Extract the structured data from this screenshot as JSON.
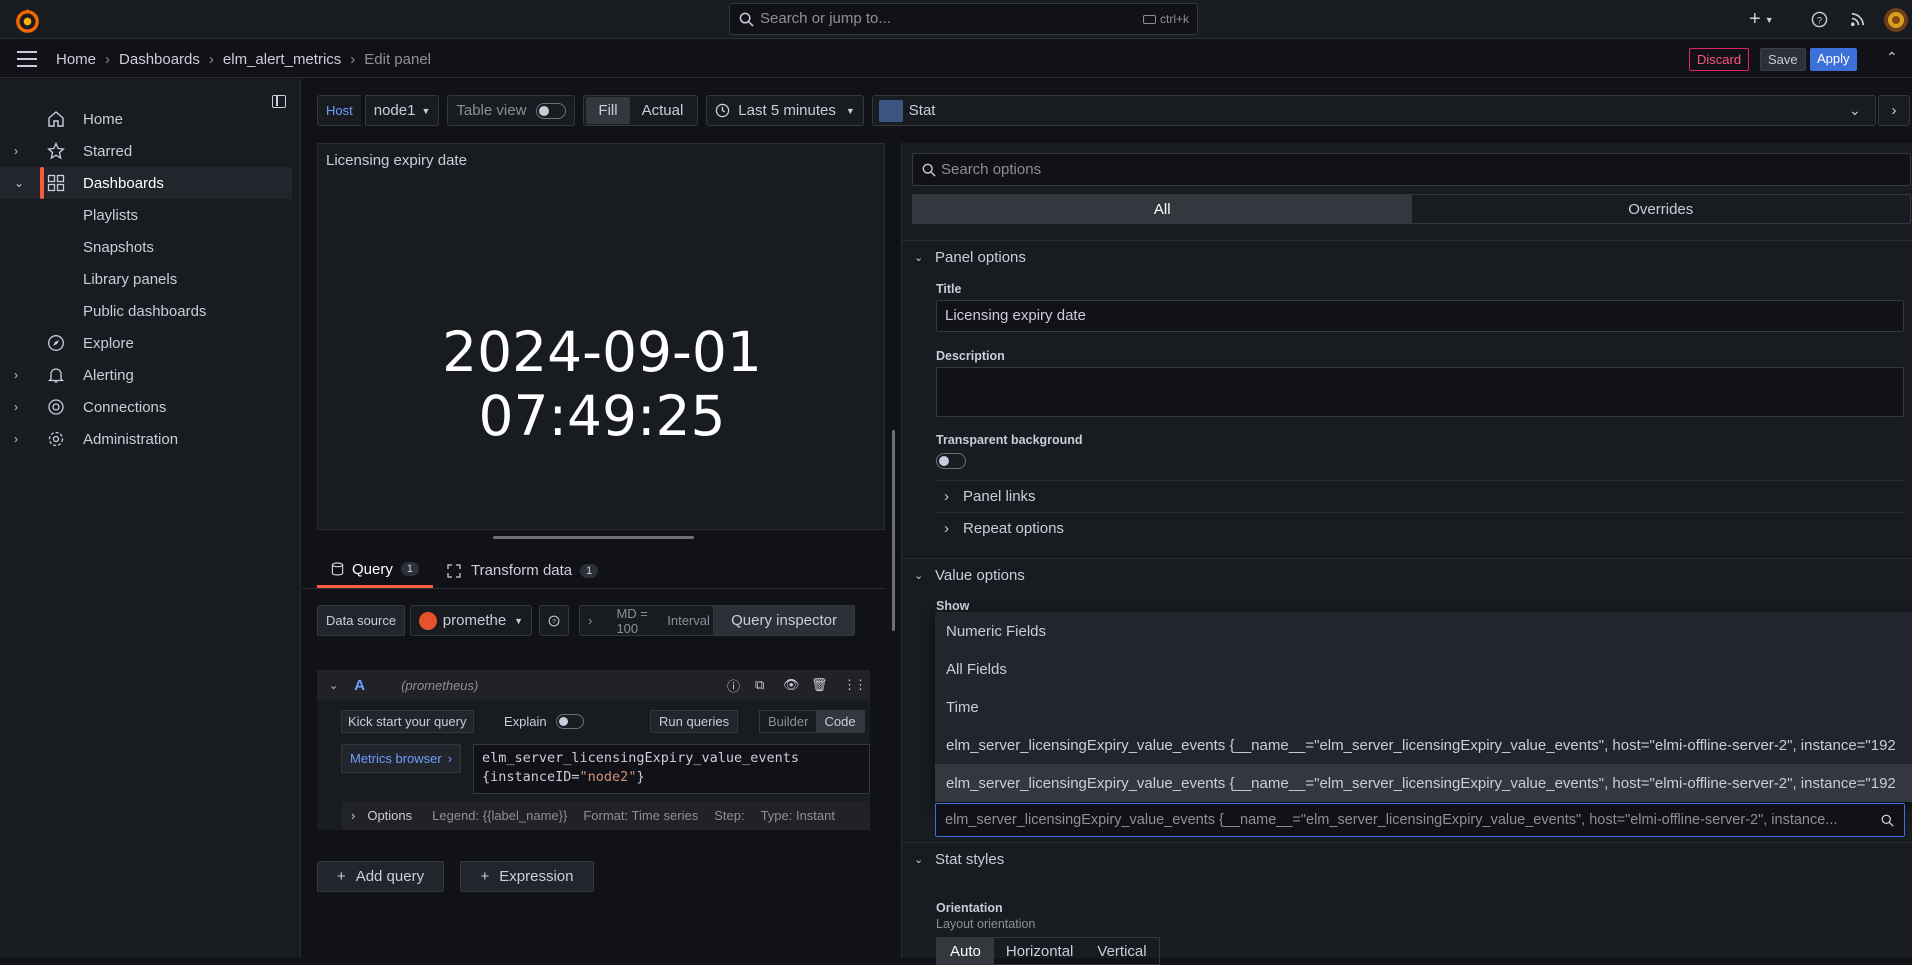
{
  "topbar": {
    "search_placeholder": "Search or jump to...",
    "shortcut": "ctrl+k",
    "plus": "+"
  },
  "breadcrumbs": [
    "Home",
    "Dashboards",
    "elm_alert_metrics",
    "Edit panel"
  ],
  "actions": {
    "discard": "Discard",
    "save": "Save",
    "apply": "Apply"
  },
  "sidebar": {
    "items": [
      {
        "label": "Home",
        "icon": "home-icon",
        "expand": false
      },
      {
        "label": "Starred",
        "icon": "star-icon",
        "expand": true
      },
      {
        "label": "Dashboards",
        "icon": "apps-icon",
        "expand": true,
        "active": true
      },
      {
        "label": "Playlists",
        "sub": true
      },
      {
        "label": "Snapshots",
        "sub": true
      },
      {
        "label": "Library panels",
        "sub": true
      },
      {
        "label": "Public dashboards",
        "sub": true
      },
      {
        "label": "Explore",
        "icon": "compass-icon",
        "expand": false
      },
      {
        "label": "Alerting",
        "icon": "bell-icon",
        "expand": true
      },
      {
        "label": "Connections",
        "icon": "connections-icon",
        "expand": true
      },
      {
        "label": "Administration",
        "icon": "gear-icon",
        "expand": true
      }
    ]
  },
  "toolbar": {
    "host_label": "Host",
    "host_value": "node1",
    "table_view": "Table view",
    "fill": "Fill",
    "actual": "Actual",
    "time_range": "Last 5 minutes",
    "viz_name": "Stat"
  },
  "panel": {
    "title": "Licensing expiry date",
    "value": "2024-09-01 07:49:25"
  },
  "tabs": {
    "query": "Query",
    "query_count": "1",
    "transform": "Transform data",
    "transform_count": "1"
  },
  "query": {
    "datasource_label": "Data source",
    "datasource": "promethe",
    "md": "MD = 100",
    "interval": "Interval = ",
    "inspector": "Query inspector",
    "ref": "A",
    "ref_ds": "(prometheus)",
    "kickstart": "Kick start your query",
    "explain": "Explain",
    "run": "Run queries",
    "builder": "Builder",
    "code": "Code",
    "metrics_browser": "Metrics browser",
    "expr_line1": "elm_server_licensingExpiry_value_events",
    "expr_line2_key": "{instanceID=",
    "expr_line2_val": "\"node2\"",
    "expr_line2_end": "}",
    "options": "Options",
    "legend": "Legend: {{label_name}}",
    "format": "Format: Time series",
    "step": "Step:",
    "type": "Type: Instant",
    "add_query": "Add query",
    "expression": "Expression"
  },
  "options": {
    "search_placeholder": "Search options",
    "seg_all": "All",
    "seg_overrides": "Overrides",
    "panel_options": "Panel options",
    "title_label": "Title",
    "title_value": "Licensing expiry date",
    "description_label": "Description",
    "transparent_label": "Transparent background",
    "panel_links": "Panel links",
    "repeat_options": "Repeat options",
    "value_options": "Value options",
    "show_label": "Show",
    "stat_styles": "Stat styles",
    "orientation_label": "Orientation",
    "orientation_desc": "Layout orientation",
    "orient_auto": "Auto",
    "orient_h": "Horizontal",
    "orient_v": "Vertical"
  },
  "dropdown": {
    "items": [
      "Numeric Fields",
      "All Fields",
      "Time",
      "elm_server_licensingExpiry_value_events {__name__=\"elm_server_licensingExpiry_value_events\", host=\"elmi-offline-server-2\", instance=\"192",
      "elm_server_licensingExpiry_value_events {__name__=\"elm_server_licensingExpiry_value_events\", host=\"elmi-offline-server-2\", instance=\"192"
    ],
    "input_placeholder": "elm_server_licensingExpiry_value_events {__name__=\"elm_server_licensingExpiry_value_events\", host=\"elmi-offline-server-2\", instance..."
  }
}
